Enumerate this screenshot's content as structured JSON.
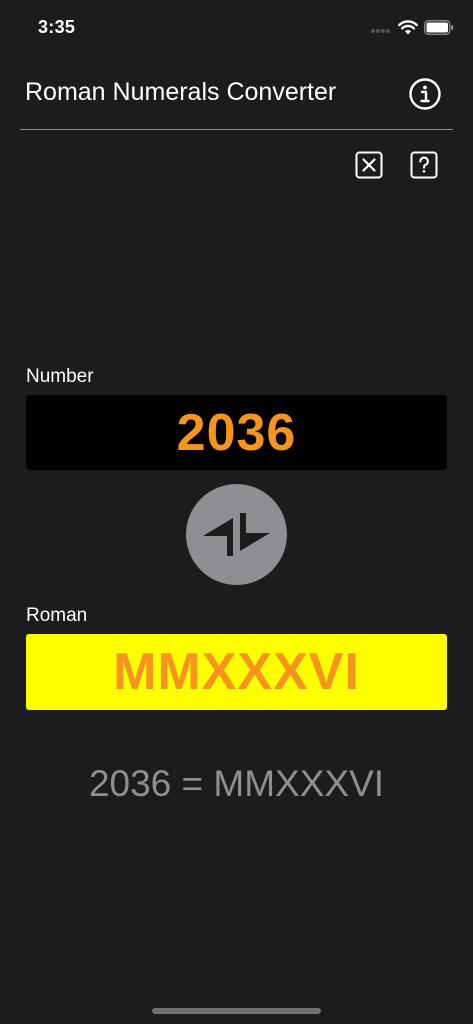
{
  "status_bar": {
    "time": "3:35",
    "icons": [
      "signal-dots-icon",
      "wifi-icon",
      "battery-icon"
    ]
  },
  "nav": {
    "title": "Roman Numerals Converter",
    "info_icon": "info-circle-icon"
  },
  "toolbar": {
    "clear_icon": "clear-square-icon",
    "help_icon": "question-square-icon"
  },
  "number_section": {
    "label": "Number",
    "value": "2036"
  },
  "swap": {
    "icon": "swap-arrows-icon"
  },
  "roman_section": {
    "label": "Roman",
    "value": "MMXXXVI"
  },
  "result": {
    "text": "2036 = MMXXXVI"
  },
  "colors": {
    "background": "#1c1c1e",
    "accent_orange": "#f7941d",
    "roman_field_bg": "#ffff00",
    "number_field_bg": "#000000",
    "muted_gray": "#8e8e93"
  }
}
